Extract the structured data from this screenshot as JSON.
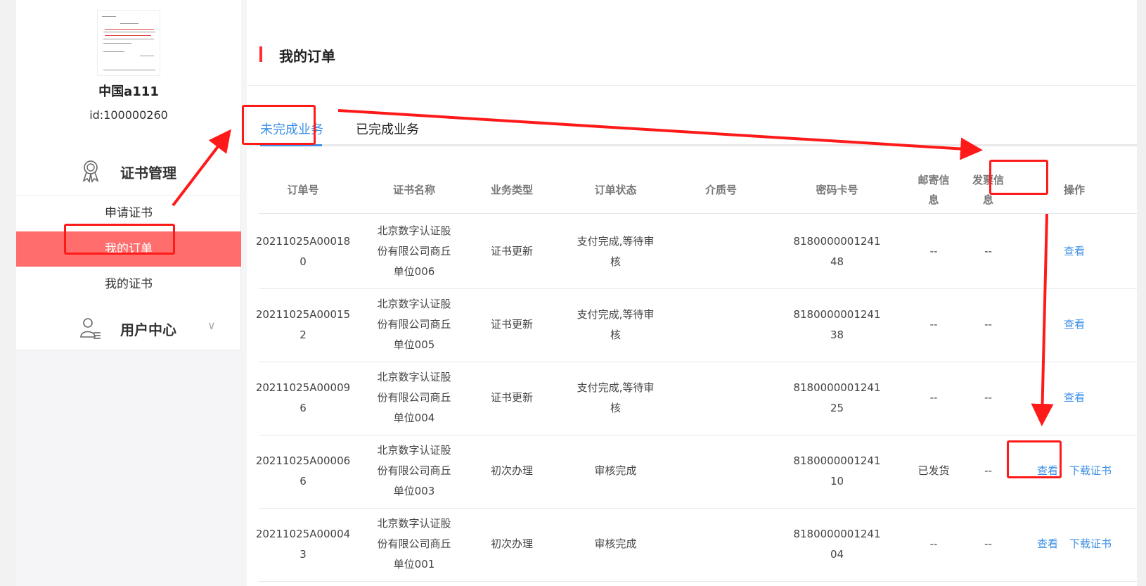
{
  "user": {
    "name": "中国a111",
    "id": "id:100000260"
  },
  "sidebar": {
    "groups": [
      {
        "label": "证书管理",
        "icon": "award-icon"
      },
      {
        "label": "用户中心",
        "icon": "user-list-icon"
      }
    ],
    "items": [
      {
        "label": "申请证书"
      },
      {
        "label": "我的订单",
        "active": true
      },
      {
        "label": "我的证书"
      }
    ]
  },
  "page": {
    "title": "我的订单"
  },
  "tabs": [
    {
      "label": "未完成业务",
      "active": true
    },
    {
      "label": "已完成业务"
    }
  ],
  "table": {
    "headers": [
      "订单号",
      "证书名称",
      "业务类型",
      "订单状态",
      "介质号",
      "密码卡号",
      "邮寄信息",
      "发票信息",
      "操作"
    ],
    "headers_wrapped": {
      "mail": [
        "邮寄信",
        "息"
      ],
      "invoice": [
        "发票信",
        "息"
      ]
    },
    "rows": [
      {
        "order_l1": "20211025A00018",
        "order_l2": "0",
        "name_l1": "北京数字认证股",
        "name_l2": "份有限公司商丘",
        "name_l3": "单位006",
        "type": "证书更新",
        "status_l1": "支付完成,等待审",
        "status_l2": "核",
        "medium": "",
        "card_l1": "8180000001241",
        "card_l2": "48",
        "mail": "--",
        "invoice": "--",
        "view": "查看",
        "download": ""
      },
      {
        "order_l1": "20211025A00015",
        "order_l2": "2",
        "name_l1": "北京数字认证股",
        "name_l2": "份有限公司商丘",
        "name_l3": "单位005",
        "type": "证书更新",
        "status_l1": "支付完成,等待审",
        "status_l2": "核",
        "medium": "",
        "card_l1": "8180000001241",
        "card_l2": "38",
        "mail": "--",
        "invoice": "--",
        "view": "查看",
        "download": ""
      },
      {
        "order_l1": "20211025A00009",
        "order_l2": "6",
        "name_l1": "北京数字认证股",
        "name_l2": "份有限公司商丘",
        "name_l3": "单位004",
        "type": "证书更新",
        "status_l1": "支付完成,等待审",
        "status_l2": "核",
        "medium": "",
        "card_l1": "8180000001241",
        "card_l2": "25",
        "mail": "--",
        "invoice": "--",
        "view": "查看",
        "download": ""
      },
      {
        "order_l1": "20211025A00006",
        "order_l2": "6",
        "name_l1": "北京数字认证股",
        "name_l2": "份有限公司商丘",
        "name_l3": "单位003",
        "type": "初次办理",
        "status_l1": "审核完成",
        "status_l2": "",
        "medium": "",
        "card_l1": "8180000001241",
        "card_l2": "10",
        "mail": "已发货",
        "invoice": "--",
        "view": "查看",
        "download": "下载证书"
      },
      {
        "order_l1": "20211025A00004",
        "order_l2": "3",
        "name_l1": "北京数字认证股",
        "name_l2": "份有限公司商丘",
        "name_l3": "单位001",
        "type": "初次办理",
        "status_l1": "审核完成",
        "status_l2": "",
        "medium": "",
        "card_l1": "8180000001241",
        "card_l2": "04",
        "mail": "--",
        "invoice": "--",
        "view": "查看",
        "download": "下载证书"
      }
    ]
  },
  "colors": {
    "accent": "#3b8fe6",
    "active_menu": "#ff6d6d",
    "annotation": "#ff1a1a"
  }
}
